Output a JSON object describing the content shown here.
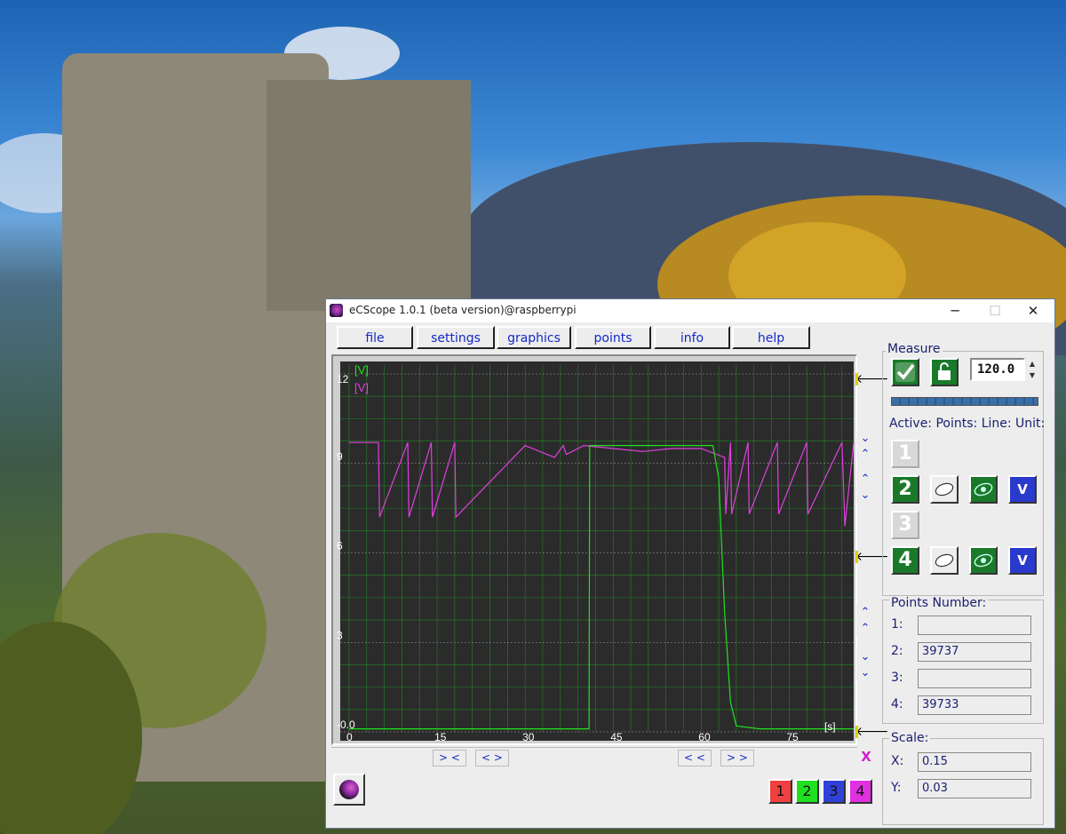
{
  "window": {
    "title": "eCScope 1.0.1 (beta version)@raspberrypi",
    "controls": [
      "─",
      "☐",
      "✕"
    ]
  },
  "menu": [
    "file",
    "settings",
    "graphics",
    "points",
    "info",
    "help"
  ],
  "plot": {
    "background": "#2b2b2b",
    "grid_color": "#1fa81f",
    "y_tick_labels": [
      "12",
      "9",
      "6",
      "3",
      "-0.0"
    ],
    "x_tick_labels": [
      "0",
      "15",
      "30",
      "45",
      "60",
      "75"
    ],
    "x_unit": "[s]",
    "y_unit_ch2": "[V]",
    "y_unit_ch4": "[V]"
  },
  "chart_data": {
    "type": "line",
    "xlabel": "[s]",
    "ylabel": "[V]",
    "xlim": [
      0,
      86
    ],
    "ylim": [
      0,
      12
    ],
    "grid": true,
    "series": [
      {
        "color": "#e040e0",
        "x": [
          0,
          5,
          5.2,
          10,
          10.2,
          14,
          14.2,
          18,
          18.2,
          30,
          35,
          36.5,
          37,
          40,
          45,
          50,
          55,
          60,
          64,
          64.2,
          65,
          65.2,
          68,
          68.2,
          73,
          73.2,
          78,
          78.2,
          84,
          84.5,
          86
        ],
        "y": [
          9.7,
          9.7,
          7.2,
          9.7,
          7.2,
          9.7,
          7.2,
          9.7,
          7.2,
          9.6,
          9.2,
          9.6,
          9.3,
          9.6,
          9.5,
          9.4,
          9.5,
          9.5,
          9.2,
          7.3,
          9.7,
          7.3,
          9.7,
          7.3,
          9.7,
          7.3,
          9.7,
          7.3,
          9.7,
          6.9,
          9.7
        ]
      },
      {
        "color": "#20e020",
        "x": [
          0,
          40.9,
          41,
          41.1,
          62,
          63,
          64,
          65,
          66,
          70,
          86
        ],
        "y": [
          0.1,
          0.1,
          9.6,
          9.6,
          9.6,
          8.5,
          4.0,
          1.0,
          0.2,
          0.1,
          0.1
        ]
      }
    ]
  },
  "scroll": {
    "btn1": "> <",
    "btn2": "< >",
    "btn3": "< <",
    "btn4": "> >",
    "close": "X"
  },
  "channels": [
    {
      "label": "1",
      "color": "#f04040"
    },
    {
      "label": "2",
      "color": "#20e020"
    },
    {
      "label": "3",
      "color": "#3040d8"
    },
    {
      "label": "4",
      "color": "#e030e0"
    }
  ],
  "measure": {
    "title": "Measure",
    "value": "120.0",
    "active_header": "Active: Points: Line: Unit:",
    "rows": [
      {
        "num": "1",
        "active": false
      },
      {
        "num": "2",
        "active": true,
        "unit": "V"
      },
      {
        "num": "3",
        "active": false
      },
      {
        "num": "4",
        "active": true,
        "unit": "V"
      }
    ]
  },
  "points": {
    "title": "Points Number:",
    "rows": [
      {
        "label": "1:",
        "value": ""
      },
      {
        "label": "2:",
        "value": "39737"
      },
      {
        "label": "3:",
        "value": ""
      },
      {
        "label": "4:",
        "value": "39733"
      }
    ]
  },
  "scale": {
    "title": "Scale:",
    "x_label": "X:",
    "x_value": "0.15",
    "y_label": "Y:",
    "y_value": "0.03"
  }
}
